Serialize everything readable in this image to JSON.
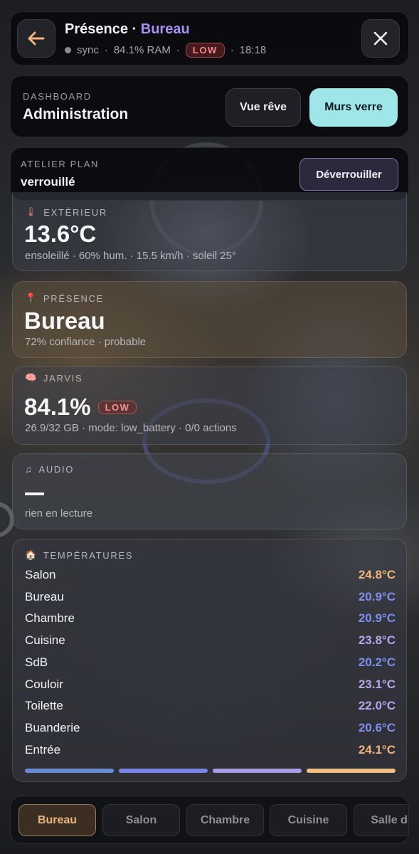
{
  "header": {
    "title_prefix": "Présence",
    "title_separator": " · ",
    "title_place": "Bureau",
    "status": "sync",
    "ram": "84.1% RAM",
    "badge": "LOW",
    "time": "18:18",
    "sep": "·"
  },
  "dashboard": {
    "label": "DASHBOARD",
    "title": "Administration",
    "btn_dream": "Vue rêve",
    "btn_glass": "Murs verre"
  },
  "atelier": {
    "label": "ATELIER PLAN",
    "value": "verrouillé",
    "btn_unlock": "Déverrouiller"
  },
  "exterior": {
    "label": "EXTÉRIEUR",
    "temp": "13.6°C",
    "details": "ensoleillé · 60% hum. · 15.5 km/h · soleil 25°"
  },
  "presence": {
    "label": "PRÉSENCE",
    "place": "Bureau",
    "details": "72% confiance · probable"
  },
  "jarvis": {
    "label": "JARVIS",
    "value": "84.1%",
    "badge": "LOW",
    "details": "26.9/32 GB · mode: low_battery · 0/0 actions"
  },
  "audio": {
    "label": "AUDIO",
    "details": "rien en lecture"
  },
  "temperatures": {
    "label": "TEMPÉRATURES",
    "rows": [
      {
        "room": "Salon",
        "value": "24.8°C",
        "color": "#f0b37a"
      },
      {
        "room": "Bureau",
        "value": "20.9°C",
        "color": "#7f8ff0"
      },
      {
        "room": "Chambre",
        "value": "20.9°C",
        "color": "#7f8ff0"
      },
      {
        "room": "Cuisine",
        "value": "23.8°C",
        "color": "#b9a5ee"
      },
      {
        "room": "SdB",
        "value": "20.2°C",
        "color": "#7f8ff0"
      },
      {
        "room": "Couloir",
        "value": "23.1°C",
        "color": "#b9a5ee"
      },
      {
        "room": "Toilette",
        "value": "22.0°C",
        "color": "#b9a5ee"
      },
      {
        "room": "Buanderie",
        "value": "20.6°C",
        "color": "#7f8ff0"
      },
      {
        "room": "Entrée",
        "value": "24.1°C",
        "color": "#f0b37a"
      }
    ],
    "bar_colors": [
      "#6a8ad8",
      "#7a84e8",
      "#a99be6",
      "#f0bf86"
    ]
  },
  "tabs": [
    "Bureau",
    "Salon",
    "Chambre",
    "Cuisine",
    "Salle de"
  ],
  "colors": {
    "accent_purple": "#a890f2",
    "accent_cyan": "#9fe6e8",
    "warm": "#f0b37a",
    "low_red": "#f08a8a"
  }
}
